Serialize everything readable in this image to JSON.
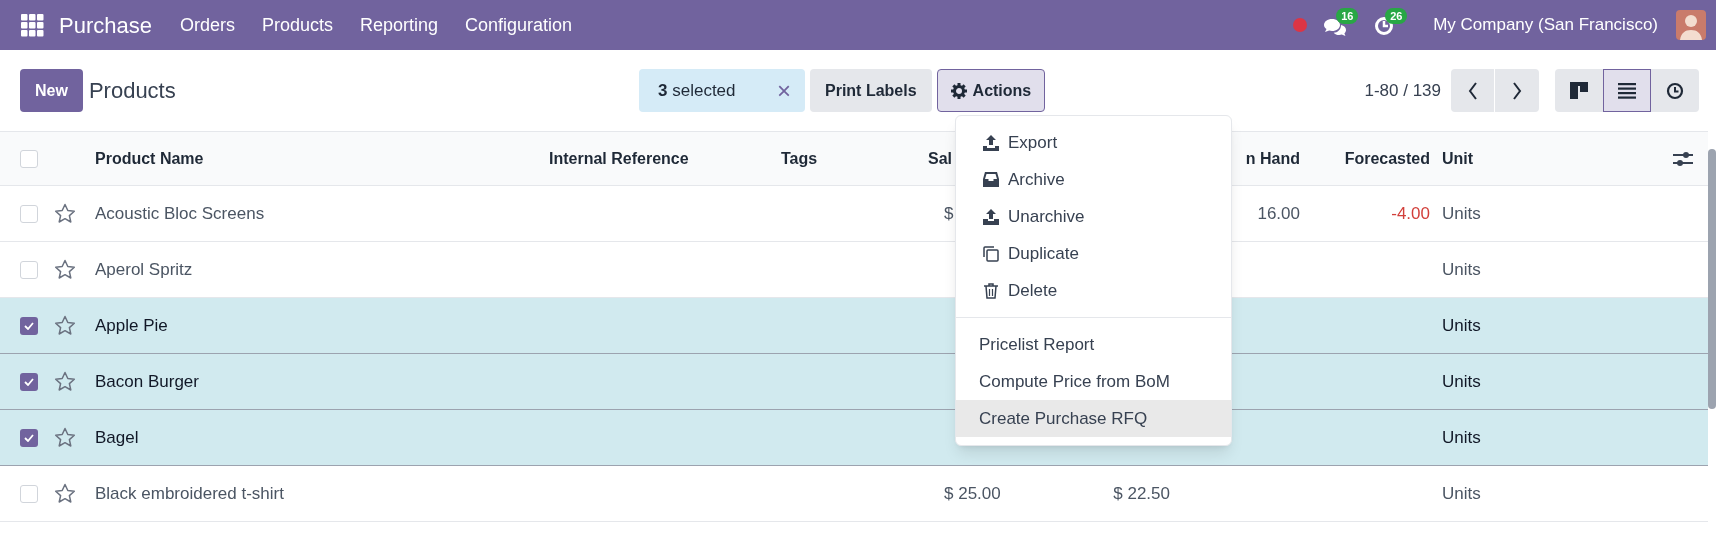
{
  "navbar": {
    "app_name": "Purchase",
    "menu": [
      "Orders",
      "Products",
      "Reporting",
      "Configuration"
    ],
    "messages_count": "16",
    "activities_count": "26",
    "company": "My Company (San Francisco)"
  },
  "control_bar": {
    "new_button": "New",
    "title": "Products",
    "selection": {
      "count": "3",
      "label": "selected",
      "clear": "×"
    },
    "print_labels": "Print Labels",
    "actions": {
      "label": "Actions",
      "expanded": true
    },
    "pager": "1-80 / 139",
    "views": [
      {
        "kind": "kanban",
        "selected": false
      },
      {
        "kind": "list",
        "selected": true
      },
      {
        "kind": "activity",
        "selected": false
      }
    ]
  },
  "actions_menu": {
    "groups": [
      [
        {
          "label": "Export",
          "selected": false
        },
        {
          "label": "Archive",
          "selected": false
        },
        {
          "label": "Unarchive",
          "selected": false
        },
        {
          "label": "Duplicate",
          "selected": false
        },
        {
          "label": "Delete",
          "selected": false
        }
      ],
      [
        {
          "label": "Pricelist Report",
          "selected": false
        },
        {
          "label": "Compute Price from BoM",
          "selected": false
        },
        {
          "label": "Create Purchase RFQ",
          "selected": true
        }
      ]
    ]
  },
  "table": {
    "select_all_checked": false,
    "columns": [
      "Product Name",
      "Internal Reference",
      "Tags",
      "Sal",
      "n Hand",
      "Forecasted",
      "Unit"
    ],
    "rows": [
      {
        "name": "Acoustic Bloc Screens",
        "selected": false,
        "sales_price": "$",
        "on_hand": "16.00",
        "forecasted": "-4.00",
        "forecast_negative": true,
        "unit": "Units"
      },
      {
        "name": "Aperol Spritz",
        "selected": false,
        "unit": "Units"
      },
      {
        "name": "Apple Pie",
        "selected": true,
        "unit": "Units"
      },
      {
        "name": "Bacon Burger",
        "selected": true,
        "unit": "Units"
      },
      {
        "name": "Bagel",
        "selected": true,
        "unit": "Units"
      },
      {
        "name": "Black embroidered t-shirt",
        "selected": false,
        "sales_price": "$ 25.00",
        "cost": "$ 22.50",
        "unit": "Units"
      }
    ]
  }
}
